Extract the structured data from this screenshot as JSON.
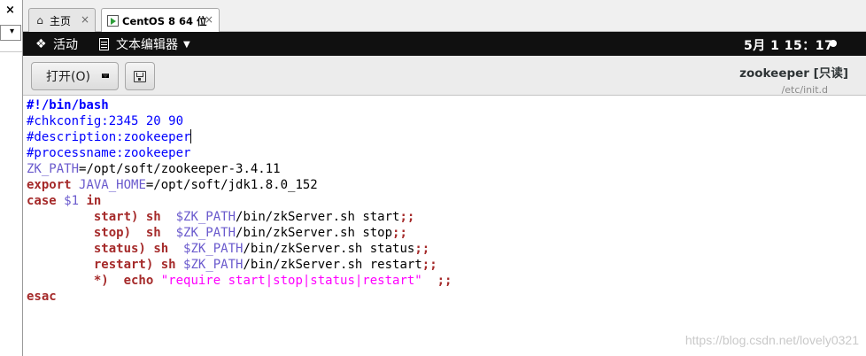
{
  "host": {
    "close_glyph": "×",
    "dropdown_glyph": "▾",
    "tabs": [
      {
        "label": "主页",
        "close": "×"
      },
      {
        "label": "CentOS 8 64 位",
        "close": "×"
      }
    ]
  },
  "topbar": {
    "activities_label": "活动",
    "app_label": "文本编辑器",
    "clock": "5月 1  15：17"
  },
  "header": {
    "open_label": "打开(O)",
    "title": "zookeeper [只读]",
    "subtitle": "/etc/init.d"
  },
  "editor": {
    "lines": [
      [
        {
          "t": "#!/bin/bash",
          "c": "c-shebang"
        }
      ],
      [
        {
          "t": "#chkconfig:2345 20 90",
          "c": "c-comment"
        }
      ],
      [
        {
          "t": "#description:zookeeper",
          "c": "c-comment"
        }
      ],
      [
        {
          "t": "#processname:zookeeper",
          "c": "c-comment"
        }
      ],
      [
        {
          "t": "ZK_PATH",
          "c": "c-var"
        },
        {
          "t": "=/opt/soft/zookeeper-3.4.11",
          "c": ""
        }
      ],
      [
        {
          "t": "export",
          "c": "c-kw"
        },
        {
          "t": " ",
          "c": ""
        },
        {
          "t": "JAVA_HOME",
          "c": "c-var"
        },
        {
          "t": "=/opt/soft/jdk1.8.0_152",
          "c": ""
        }
      ],
      [
        {
          "t": "case",
          "c": "c-kw"
        },
        {
          "t": " ",
          "c": ""
        },
        {
          "t": "$1",
          "c": "c-var"
        },
        {
          "t": " ",
          "c": ""
        },
        {
          "t": "in",
          "c": "c-kw"
        }
      ],
      [
        {
          "t": "         ",
          "c": ""
        },
        {
          "t": "start)",
          "c": "c-kw"
        },
        {
          "t": " ",
          "c": ""
        },
        {
          "t": "sh",
          "c": "c-kw"
        },
        {
          "t": "  ",
          "c": ""
        },
        {
          "t": "$ZK_PATH",
          "c": "c-var"
        },
        {
          "t": "/bin/zkServer.sh start",
          "c": ""
        },
        {
          "t": ";;",
          "c": "c-kw"
        }
      ],
      [
        {
          "t": "         ",
          "c": ""
        },
        {
          "t": "stop)",
          "c": "c-kw"
        },
        {
          "t": "  ",
          "c": ""
        },
        {
          "t": "sh",
          "c": "c-kw"
        },
        {
          "t": "  ",
          "c": ""
        },
        {
          "t": "$ZK_PATH",
          "c": "c-var"
        },
        {
          "t": "/bin/zkServer.sh stop",
          "c": ""
        },
        {
          "t": ";;",
          "c": "c-kw"
        }
      ],
      [
        {
          "t": "         ",
          "c": ""
        },
        {
          "t": "status)",
          "c": "c-kw"
        },
        {
          "t": " ",
          "c": ""
        },
        {
          "t": "sh",
          "c": "c-kw"
        },
        {
          "t": "  ",
          "c": ""
        },
        {
          "t": "$ZK_PATH",
          "c": "c-var"
        },
        {
          "t": "/bin/zkServer.sh status",
          "c": ""
        },
        {
          "t": ";;",
          "c": "c-kw"
        }
      ],
      [
        {
          "t": "         ",
          "c": ""
        },
        {
          "t": "restart)",
          "c": "c-kw"
        },
        {
          "t": " ",
          "c": ""
        },
        {
          "t": "sh",
          "c": "c-kw"
        },
        {
          "t": " ",
          "c": ""
        },
        {
          "t": "$ZK_PATH",
          "c": "c-var"
        },
        {
          "t": "/bin/zkServer.sh restart",
          "c": ""
        },
        {
          "t": ";;",
          "c": "c-kw"
        }
      ],
      [
        {
          "t": "         ",
          "c": ""
        },
        {
          "t": "*)",
          "c": "c-kw"
        },
        {
          "t": "  ",
          "c": ""
        },
        {
          "t": "echo",
          "c": "c-kw"
        },
        {
          "t": " ",
          "c": ""
        },
        {
          "t": "\"require start|stop|status|restart\"",
          "c": "c-str"
        },
        {
          "t": "  ",
          "c": ""
        },
        {
          "t": ";;",
          "c": "c-kw"
        }
      ],
      [
        {
          "t": "esac",
          "c": "c-kw"
        }
      ]
    ],
    "cursor_line": 2
  },
  "watermark": "https://blog.csdn.net/lovely0321",
  "colors": {
    "comment": "#0000ff",
    "keyword": "#a52a2a",
    "variable": "#6a5acd",
    "string": "#ff00ff",
    "topbar_bg": "#101010"
  }
}
